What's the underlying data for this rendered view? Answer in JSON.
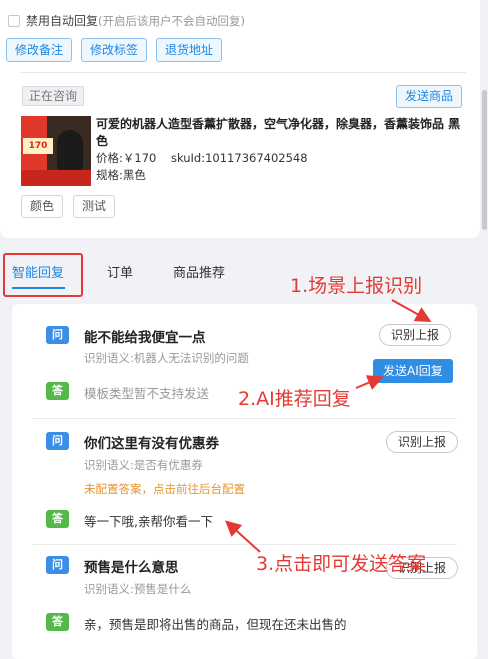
{
  "settings": {
    "disable_auto_reply_label": "禁用自动回复",
    "disable_auto_reply_hint": "(开启后该用户不会自动回复)",
    "buttons": [
      "修改备注",
      "修改标签",
      "退货地址"
    ]
  },
  "consult": {
    "status": "正在咨询",
    "send_product_label": "发送商品",
    "product": {
      "title": "可爱的机器人造型香薰扩散器，空气净化器，除臭器，香薰装饰品 黑色",
      "price_label": "价格:",
      "price": "￥170",
      "sku_label": "skuId:",
      "sku_id": "10117367402548",
      "spec_label": "规格:",
      "spec": "黑色",
      "image_badge_price": "170",
      "tags": [
        "颜色",
        "测试"
      ]
    }
  },
  "tabs": [
    "智能回复",
    "订单",
    "商品推荐"
  ],
  "qa_items": [
    {
      "question_badge": "问",
      "question": "能不能给我便宜一点",
      "semantic": "识别语义:机器人无法识别的问题",
      "report_label": "识别上报",
      "ai_button_label": "发送AI回复",
      "answer_badge": "答",
      "answer": "模板类型暂不支持发送"
    },
    {
      "question_badge": "问",
      "question": "你们这里有没有优惠券",
      "semantic": "识别语义:是否有优惠券",
      "warning": "未配置答案，点击前往后台配置",
      "report_label": "识别上报",
      "answer_badge": "答",
      "answer": "等一下哦,亲帮你看一下"
    },
    {
      "question_badge": "问",
      "question": "预售是什么意思",
      "semantic": "识别语义:预售是什么",
      "report_label": "识别上报",
      "answer_badge": "答",
      "answer": "亲，预售是即将出售的商品，但现在还未出售的"
    }
  ],
  "annotations": [
    "1.场景上报识别",
    "2.AI推荐回复",
    "3.点击即可发送答案"
  ],
  "colors": {
    "accent": "#1e88e5",
    "annotation": "#e53935",
    "question_badge": "#3a8ee6",
    "answer_badge": "#54b948",
    "warning": "#e6962d"
  }
}
